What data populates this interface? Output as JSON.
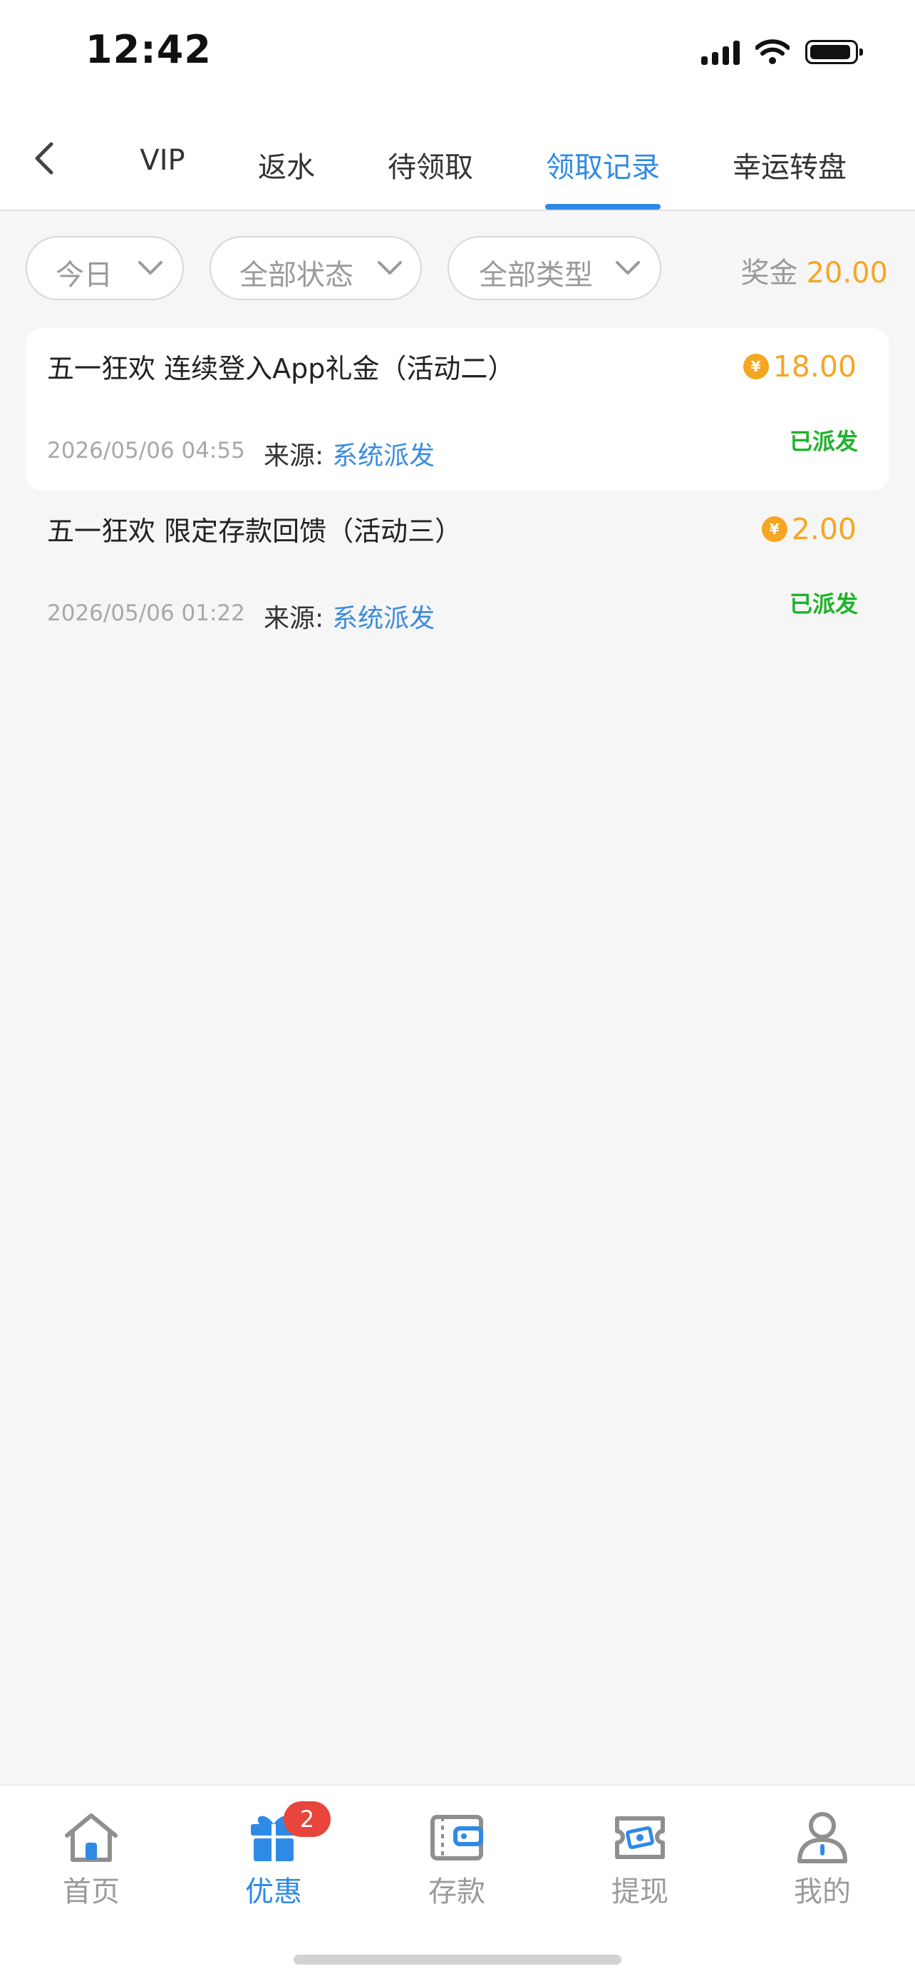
{
  "status_bar": {
    "time": "12:42"
  },
  "header": {
    "tabs": [
      {
        "label": "VIP",
        "active": false
      },
      {
        "label": "返水",
        "active": false
      },
      {
        "label": "待领取",
        "active": false
      },
      {
        "label": "领取记录",
        "active": true
      },
      {
        "label": "幸运转盘",
        "active": false
      }
    ]
  },
  "filters": {
    "date": "今日",
    "status": "全部状态",
    "type": "全部类型",
    "bonus_label": "奖金",
    "bonus_value": "20.00"
  },
  "records": [
    {
      "title": "五一狂欢 连续登入App礼金（活动二）",
      "amount": "18.00",
      "status": "已派发",
      "date": "2026/05/06 04:55",
      "source_label": "来源:",
      "source_value": "系统派发"
    },
    {
      "title": "五一狂欢 限定存款回馈（活动三）",
      "amount": "2.00",
      "status": "已派发",
      "date": "2026/05/06 01:22",
      "source_label": "来源:",
      "source_value": "系统派发"
    }
  ],
  "coin_symbol": "¥",
  "bottom_nav": {
    "items": [
      {
        "label": "首页",
        "icon": "home-icon"
      },
      {
        "label": "优惠",
        "icon": "gift-icon",
        "active": true,
        "badge": "2"
      },
      {
        "label": "存款",
        "icon": "wallet-icon"
      },
      {
        "label": "提现",
        "icon": "withdraw-icon"
      },
      {
        "label": "我的",
        "icon": "user-icon"
      }
    ]
  },
  "colors": {
    "accent": "#2f8ae6",
    "gold": "#f5a623",
    "success": "#1fb32b",
    "badge": "#e8453c"
  }
}
